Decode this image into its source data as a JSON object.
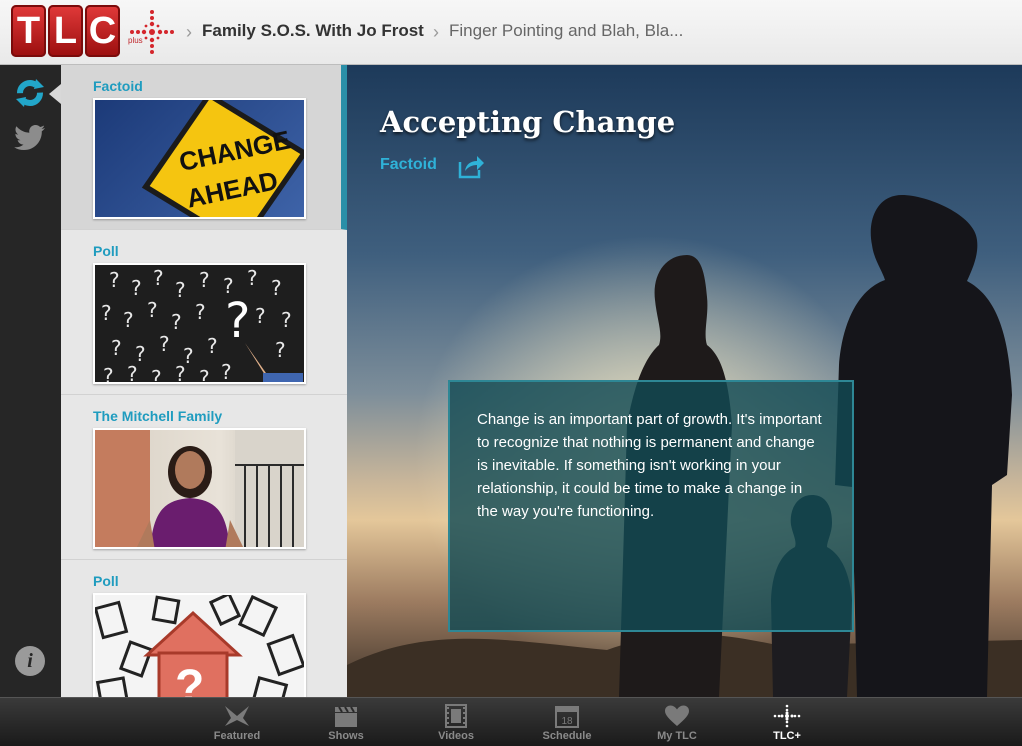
{
  "header": {
    "brand": "TLC",
    "brand_sub": "plus",
    "breadcrumb_show": "Family S.O.S. With Jo Frost",
    "breadcrumb_episode": "Finger Pointing and Blah, Bla..."
  },
  "rail": {
    "icons": [
      "refresh-icon",
      "twitter-icon",
      "info-icon"
    ],
    "info_label": "i"
  },
  "list": {
    "items": [
      {
        "tag": "Factoid",
        "image": "change-ahead-sign",
        "thumb_text_1": "CHANGE",
        "thumb_text_2": "AHEAD"
      },
      {
        "tag": "Poll",
        "image": "question-marks-chalkboard"
      },
      {
        "tag": "The Mitchell Family",
        "image": "woman-on-porch"
      },
      {
        "tag": "Poll",
        "image": "house-question-mark",
        "thumb_text_1": "?"
      }
    ]
  },
  "main": {
    "title": "Accepting Change",
    "kind": "Factoid",
    "body": "Change is an important part of growth. It's important to recognize that nothing is permanent and change is inevitable. If something isn't working in your relationship, it could be time to make a change in the way you're functioning."
  },
  "tabs": [
    {
      "label": "Featured",
      "icon": "featured-icon"
    },
    {
      "label": "Shows",
      "icon": "clapboard-icon"
    },
    {
      "label": "Videos",
      "icon": "film-icon"
    },
    {
      "label": "Schedule",
      "icon": "calendar-icon",
      "icon_text": "18"
    },
    {
      "label": "My TLC",
      "icon": "heart-icon"
    },
    {
      "label": "TLC+",
      "icon": "tlc-plus-icon",
      "active": true
    }
  ],
  "colors": {
    "accent": "#1f9cbf",
    "brand_red": "#c0282d",
    "textbox_bg": "#124a54"
  }
}
